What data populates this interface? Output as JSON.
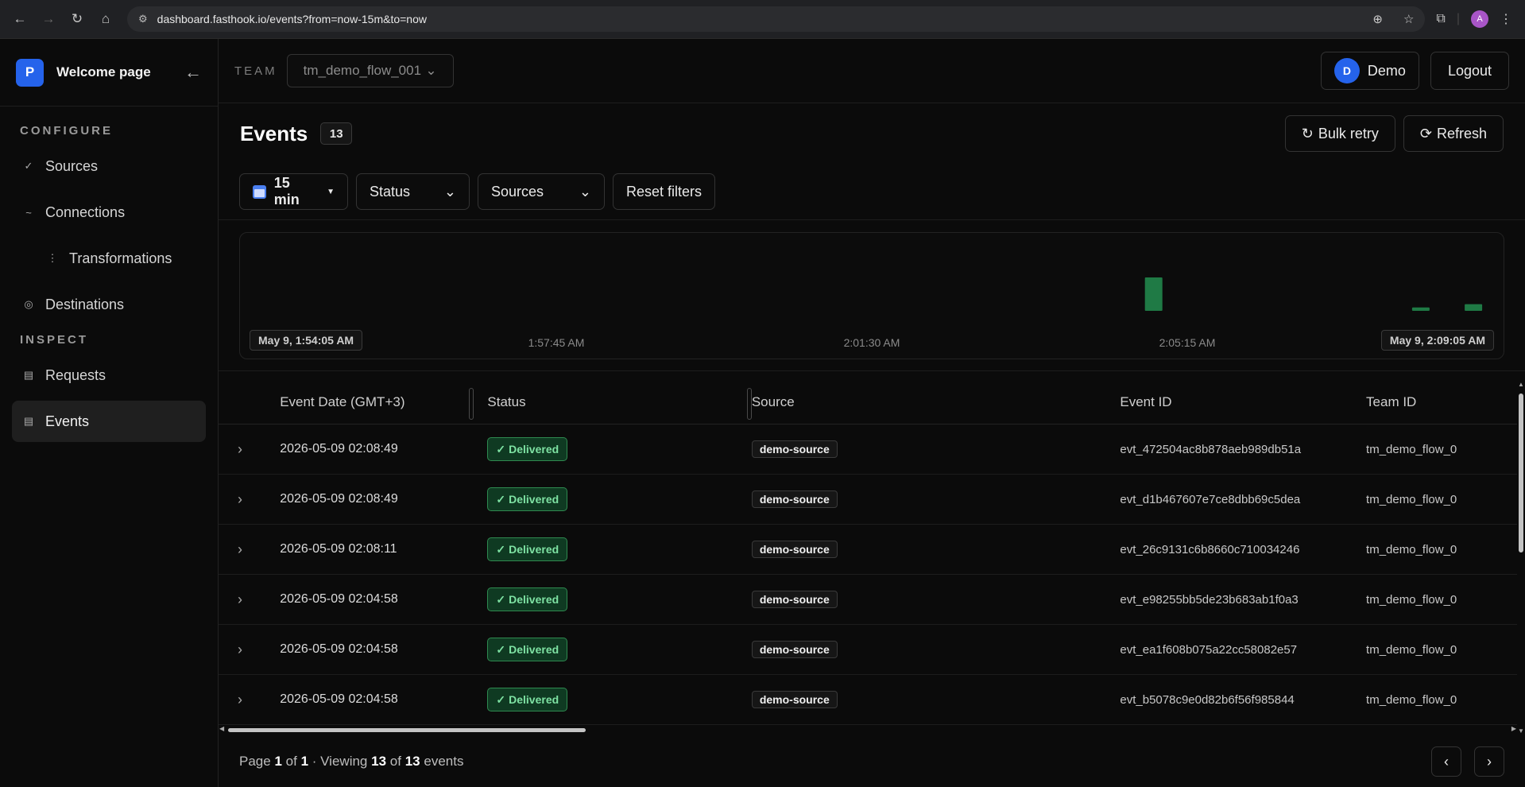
{
  "browser": {
    "url": "dashboard.fasthook.io/events?from=now-15m&to=now",
    "profile_initial": "A"
  },
  "sidebar": {
    "brand_initial": "P",
    "brand_name": "Welcome page",
    "configure_label": "CONFIGURE",
    "inspect_label": "INSPECT",
    "configure_items": [
      {
        "label": "Sources",
        "icon": "check-icon"
      },
      {
        "label": "Connections",
        "icon": "tilde-icon"
      },
      {
        "label": "Transformations",
        "icon": "vertical-dots-icon"
      },
      {
        "label": "Destinations",
        "icon": "target-icon"
      }
    ],
    "inspect_items": [
      {
        "label": "Requests",
        "icon": "list-icon"
      },
      {
        "label": "Events",
        "icon": "list-icon",
        "active": true
      }
    ]
  },
  "topbar": {
    "team_label": "TEAM",
    "team_value": "tm_demo_flow_001",
    "user_initial": "D",
    "user_name": "Demo",
    "logout_label": "Logout"
  },
  "page": {
    "title": "Events",
    "count": "13",
    "bulk_retry_label": "Bulk retry",
    "refresh_label": "Refresh"
  },
  "filters": {
    "time_label": "15 min",
    "status_label": "Status",
    "sources_label": "Sources",
    "reset_label": "Reset filters"
  },
  "histogram": {
    "start_label": "May 9, 1:54:05 AM",
    "end_label": "May 9, 2:09:05 AM",
    "ticks": [
      "1:57:45 AM",
      "2:01:30 AM",
      "2:05:15 AM"
    ],
    "bar_color": "#1f7a45",
    "bars": [
      {
        "time": "2:04:58 AM",
        "count": 10
      },
      {
        "time": "2:08:11 AM",
        "count": 1
      },
      {
        "time": "2:08:49 AM",
        "count": 2
      }
    ],
    "max_count": 10
  },
  "table": {
    "headers": {
      "date": "Event Date (GMT+3)",
      "status": "Status",
      "source": "Source",
      "event_id": "Event ID",
      "team_id": "Team ID"
    },
    "rows": [
      {
        "date": "2026-05-09 02:08:49",
        "status": "Delivered",
        "source": "demo-source",
        "event_id": "evt_472504ac8b878aeb989db51a",
        "team_id": "tm_demo_flow_0"
      },
      {
        "date": "2026-05-09 02:08:49",
        "status": "Delivered",
        "source": "demo-source",
        "event_id": "evt_d1b467607e7ce8dbb69c5dea",
        "team_id": "tm_demo_flow_0"
      },
      {
        "date": "2026-05-09 02:08:11",
        "status": "Delivered",
        "source": "demo-source",
        "event_id": "evt_26c9131c6b8660c710034246",
        "team_id": "tm_demo_flow_0"
      },
      {
        "date": "2026-05-09 02:04:58",
        "status": "Delivered",
        "source": "demo-source",
        "event_id": "evt_e98255bb5de23b683ab1f0a3",
        "team_id": "tm_demo_flow_0"
      },
      {
        "date": "2026-05-09 02:04:58",
        "status": "Delivered",
        "source": "demo-source",
        "event_id": "evt_ea1f608b075a22cc58082e57",
        "team_id": "tm_demo_flow_0"
      },
      {
        "date": "2026-05-09 02:04:58",
        "status": "Delivered",
        "source": "demo-source",
        "event_id": "evt_b5078c9e0d82b6f56f985844",
        "team_id": "tm_demo_flow_0"
      }
    ]
  },
  "pager": {
    "page_word": "Page",
    "page": "1",
    "of_word": "of",
    "pages": "1",
    "viewing_word": "· Viewing",
    "shown": "13",
    "of_word2": "of",
    "total": "13",
    "events_word": "events"
  }
}
